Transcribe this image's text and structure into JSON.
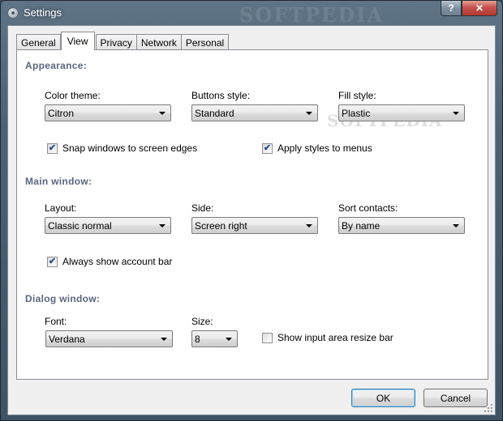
{
  "window": {
    "title": "Settings",
    "watermark": "SOFTPEDIA"
  },
  "tabs": [
    "General",
    "View",
    "Privacy",
    "Network",
    "Personal"
  ],
  "active_tab": "View",
  "appearance": {
    "title": "Appearance:",
    "color_theme": {
      "label": "Color theme:",
      "value": "Citron"
    },
    "buttons_style": {
      "label": "Buttons style:",
      "value": "Standard"
    },
    "fill_style": {
      "label": "Fill style:",
      "value": "Plastic"
    },
    "snap_windows": {
      "label": "Snap windows to screen edges",
      "checked": true
    },
    "apply_styles": {
      "label": "Apply styles to menus",
      "checked": true
    }
  },
  "main_window": {
    "title": "Main window:",
    "layout": {
      "label": "Layout:",
      "value": "Classic normal"
    },
    "side": {
      "label": "Side:",
      "value": "Screen right"
    },
    "sort_contacts": {
      "label": "Sort contacts:",
      "value": "By name"
    },
    "always_show_account_bar": {
      "label": "Always show account bar",
      "checked": true
    }
  },
  "dialog_window": {
    "title": "Dialog window:",
    "font": {
      "label": "Font:",
      "value": "Verdana"
    },
    "size": {
      "label": "Size:",
      "value": "8"
    },
    "show_resize_bar": {
      "label": "Show input area resize bar",
      "checked": false
    }
  },
  "buttons": {
    "ok": "OK",
    "cancel": "Cancel"
  },
  "icons": {
    "app": "gear-icon",
    "help": "question-mark-icon",
    "close": "close-icon",
    "check": "checkmark-icon",
    "dropdown": "chevron-down-icon"
  },
  "colors": {
    "section_title": "#3b4c68",
    "close_button": "#c75050",
    "default_button_border": "#3c7fb1"
  }
}
